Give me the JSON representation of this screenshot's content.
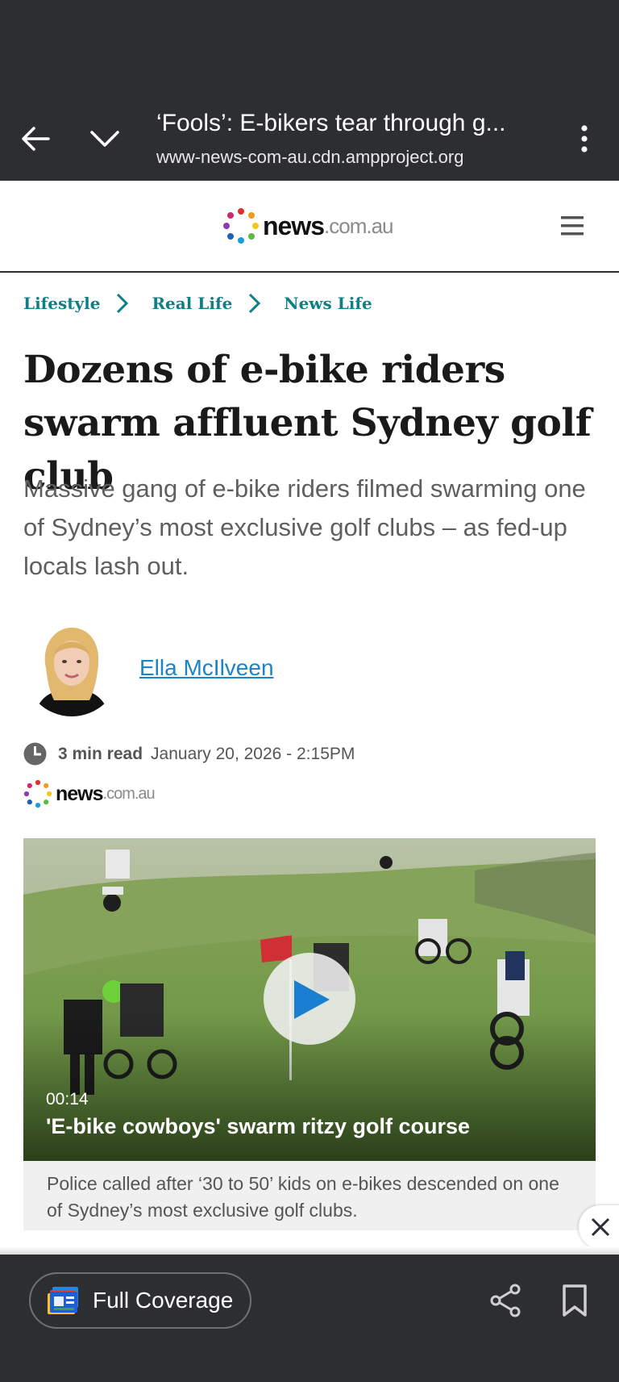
{
  "browser": {
    "title": "‘Fools’: E-bikers tear through g...",
    "url": "www-news-com-au.cdn.ampproject.org",
    "back_icon": "arrow-left-icon",
    "minimize_icon": "chevron-down-icon",
    "menu_icon": "more-vert-icon"
  },
  "site": {
    "brand": "news",
    "tld": ".com.au",
    "menu_icon": "hamburger-icon"
  },
  "breadcrumb": [
    "Lifestyle",
    "Real Life",
    "News Life"
  ],
  "article": {
    "headline": "Dozens of e-bike riders swarm affluent Sydney golf club",
    "standfirst": "Massive gang of e-bike riders filmed swarming one of Sydney’s most exclusive golf clubs – as fed-up locals lash out.",
    "author": "Ella McIlveen",
    "read_time": "3 min read",
    "date": "January 20, 2026 - 2:15PM",
    "source_brand": "news",
    "source_tld": ".com.au"
  },
  "video": {
    "duration": "00:14",
    "title": "'E-bike cowboys' swarm ritzy golf course",
    "caption": "Police called after ‘30 to 50’ kids on e-bikes descended on one of Sydney’s most exclusive golf clubs."
  },
  "bottom_bar": {
    "full_coverage_label": "Full Coverage",
    "share_icon": "share-icon",
    "bookmark_icon": "bookmark-icon"
  },
  "colors": {
    "browser_bar": "#2d2e32",
    "breadcrumb": "#0f7f86",
    "author_link": "#1a84c6",
    "play_triangle": "#1a7fd0"
  }
}
